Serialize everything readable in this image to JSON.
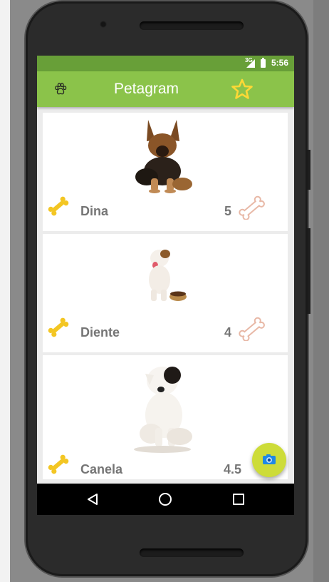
{
  "status_bar": {
    "time": "5:56",
    "network": "3G"
  },
  "app_bar": {
    "title": "Petagram",
    "left_icon": "paw-icon",
    "right_icon": "star-icon"
  },
  "pets": [
    {
      "name": "Dina",
      "rating": "5"
    },
    {
      "name": "Diente",
      "rating": "4"
    },
    {
      "name": "Canela",
      "rating": "4.5"
    }
  ],
  "fab": {
    "icon": "camera-icon"
  },
  "nav_bar": {
    "buttons": [
      "back-icon",
      "home-icon",
      "recents-icon"
    ]
  },
  "colors": {
    "primary": "#8bc34a",
    "primary_dark": "#689f38",
    "accent": "#cddc39",
    "text": "#757575"
  }
}
